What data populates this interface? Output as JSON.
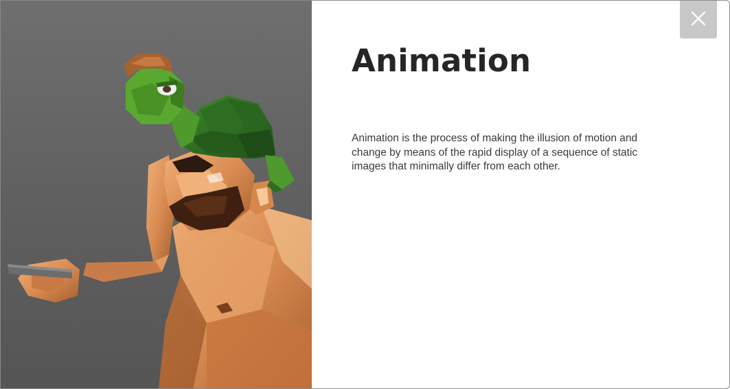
{
  "modal": {
    "title": "Animation",
    "description": "Animation is the process of making the illusion of motion and change by means of the rapid display of a sequence of static images that minimally differ from each other.",
    "close_icon": "close-icon",
    "image": {
      "subject": "low-poly 3D character with turtle on head",
      "colors": {
        "background": "#666666",
        "skin": "#d98c52",
        "turtle_shell": "#2f6e22",
        "turtle_skin": "#4e9a2c"
      }
    }
  }
}
